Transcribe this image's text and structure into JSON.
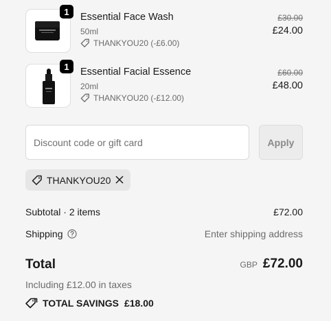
{
  "cart": {
    "items": [
      {
        "quantity": "1",
        "name": "Essential Face Wash",
        "variant": "50ml",
        "discount": "THANKYOU20 (-£6.00)",
        "original_price": "£30.00",
        "price": "£24.00",
        "image": "face-wash-jar"
      },
      {
        "quantity": "1",
        "name": "Essential Facial Essence",
        "variant": "20ml",
        "discount": "THANKYOU20 (-£12.00)",
        "original_price": "£60.00",
        "price": "£48.00",
        "image": "essence-bottle"
      }
    ]
  },
  "discount": {
    "placeholder": "Discount code or gift card",
    "apply_label": "Apply",
    "applied_code": "THANKYOU20"
  },
  "summary": {
    "subtotal_label": "Subtotal · 2 items",
    "subtotal_value": "£72.00",
    "shipping_label": "Shipping",
    "shipping_value": "Enter shipping address",
    "total_label": "Total",
    "currency": "GBP",
    "total_value": "£72.00",
    "taxes_text": "Including £12.00 in taxes",
    "savings_label": "TOTAL SAVINGS",
    "savings_value": "£18.00"
  },
  "icons": {
    "tag": "tag-icon",
    "remove": "close-icon",
    "help": "question-circle-icon",
    "savings": "tags-icon"
  }
}
